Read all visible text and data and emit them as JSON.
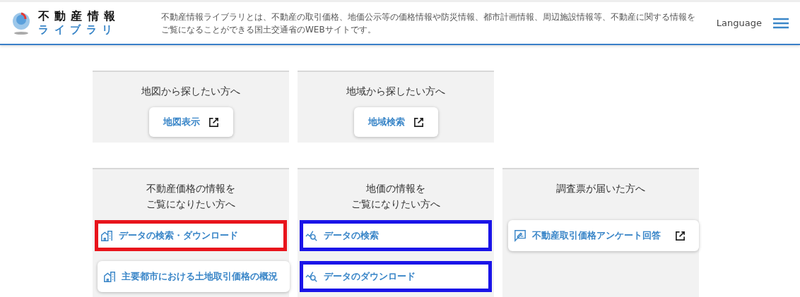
{
  "header": {
    "logo_top": "不動産情報",
    "logo_bottom": "ライブラリ",
    "description": [
      "不動産情報ライブラリとは、不動産の取引価格、地価公示等の価格情報や防災情報、都市計画情報、周辺施設情報等、不動産に関する情報を",
      "ご覧になることができる国土交通省のWEBサイトです。"
    ],
    "language": "Language"
  },
  "rows": [
    {
      "cards": [
        {
          "title": [
            "地図から探したい方へ"
          ],
          "links": [
            {
              "kind": "external",
              "label": "地図表示"
            }
          ]
        },
        {
          "title": [
            "地域から探したい方へ"
          ],
          "links": [
            {
              "kind": "external",
              "label": "地域検索"
            }
          ]
        }
      ]
    },
    {
      "cards": [
        {
          "title": [
            "不動産価格の情報を",
            "ご覧になりたい方へ"
          ],
          "links": [
            {
              "kind": "building",
              "label": "データの検索・ダウンロード",
              "color": "#e8141c"
            },
            {
              "kind": "building",
              "label": "主要都市における土地取引価格の概況"
            }
          ]
        },
        {
          "title": [
            "地価の情報を",
            "ご覧になりたい方へ"
          ],
          "links": [
            {
              "kind": "chart",
              "label": "データの検索",
              "color": "#1a14e8"
            },
            {
              "kind": "chart",
              "label": "データのダウンロード",
              "color": "#1a14e8"
            }
          ]
        },
        {
          "title": [
            "調査票が届いた方へ"
          ],
          "links": [
            {
              "kind": "survey",
              "label": "不動産取引価格アンケート回答"
            }
          ]
        }
      ]
    }
  ]
}
